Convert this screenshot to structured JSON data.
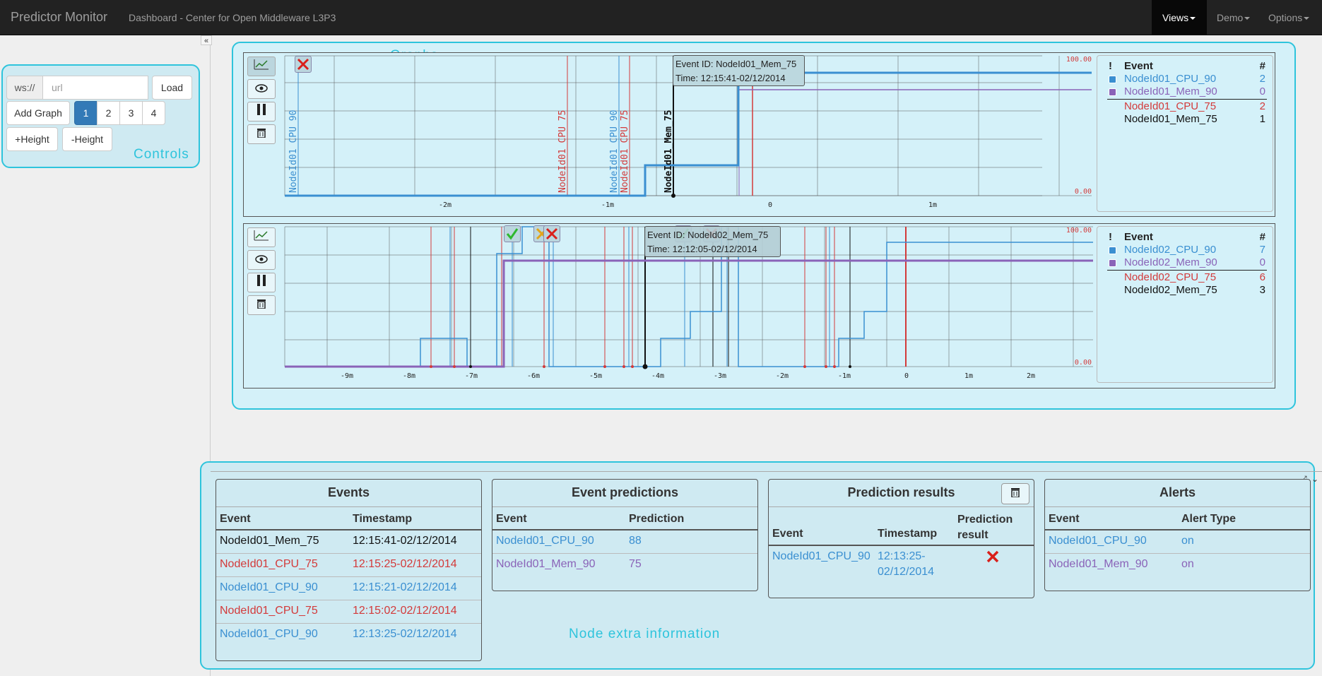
{
  "navbar": {
    "brand": "Predictor Monitor",
    "subtitle": "Dashboard - Center for Open Middleware L3P3",
    "menu": [
      {
        "label": "Views",
        "active": true
      },
      {
        "label": "Demo",
        "active": false
      },
      {
        "label": "Options",
        "active": false
      }
    ]
  },
  "controls": {
    "ws_prefix": "ws://",
    "url_placeholder": "url",
    "load_label": "Load",
    "add_graph_label": "Add Graph",
    "graph_count_options": [
      "1",
      "2",
      "3",
      "4"
    ],
    "selected_count": "1",
    "increase_height_label": "+Height",
    "decrease_height_label": "-Height",
    "collapse_icon": "double-chevron-left-icon"
  },
  "annotations": {
    "controls": "Controls",
    "graphs": "Graphs",
    "node_extra": "Node extra information"
  },
  "colors": {
    "cpu_90": "#3a8fd1",
    "mem_90": "#8a63b8",
    "cpu_75": "#d33a3a",
    "mem_75": "#111111",
    "region_outline": "#2ec4dc",
    "graph_bg": "#d4f1f9",
    "ok": "#2eb82e",
    "fail": "#d9201b",
    "warn": "#e2a51a"
  },
  "graph_buttons": [
    "chart-icon",
    "eye-icon",
    "pause-icon",
    "trash-icon"
  ],
  "graphs": [
    {
      "ymax_label": "100.00",
      "ymin_label": "0.00",
      "x_ticks": [
        "-2m",
        "-1m",
        "0",
        "1m"
      ],
      "tooltip": {
        "event_id": "Event ID: NodeId01_Mem_75",
        "time": "Time: 12:15:41-02/12/2014"
      },
      "event_labels": [
        {
          "text": "NodeId01_CPU_90",
          "series": "cpu_90"
        },
        {
          "text": "NodeId01_CPU_75",
          "series": "cpu_75"
        },
        {
          "text": "NodeId01_CPU_90",
          "series": "cpu_90"
        },
        {
          "text": "NodeId01_CPU_75",
          "series": "cpu_75"
        },
        {
          "text": "NodeId01_Mem_75",
          "series": "mem_75"
        }
      ],
      "legend": {
        "header_bang": "!",
        "header_event": "Event",
        "header_count": "#",
        "rows": [
          {
            "name": "NodeId01_CPU_90",
            "count": "2",
            "series": "cpu_90",
            "marker": true
          },
          {
            "name": "NodeId01_Mem_90",
            "count": "0",
            "series": "mem_90",
            "marker": true
          },
          {
            "name": "NodeId01_CPU_75",
            "count": "2",
            "series": "cpu_75",
            "marker": false
          },
          {
            "name": "NodeId01_Mem_75",
            "count": "1",
            "series": "mem_75",
            "marker": false
          }
        ]
      }
    },
    {
      "ymax_label": "100.00",
      "ymin_label": "0.00",
      "x_ticks": [
        "-9m",
        "-8m",
        "-7m",
        "-6m",
        "-5m",
        "-4m",
        "-3m",
        "-2m",
        "-1m",
        "0",
        "1m",
        "2m"
      ],
      "tooltip": {
        "event_id": "Event ID: NodeId02_Mem_75",
        "time": "Time: 12:12:05-02/12/2014"
      },
      "legend": {
        "header_bang": "!",
        "header_event": "Event",
        "header_count": "#",
        "rows": [
          {
            "name": "NodeId02_CPU_90",
            "count": "7",
            "series": "cpu_90",
            "marker": true
          },
          {
            "name": "NodeId02_Mem_90",
            "count": "0",
            "series": "mem_90",
            "marker": true
          },
          {
            "name": "NodeId02_CPU_75",
            "count": "6",
            "series": "cpu_75",
            "marker": false
          },
          {
            "name": "NodeId02_Mem_75",
            "count": "3",
            "series": "mem_75",
            "marker": false
          }
        ]
      }
    }
  ],
  "events_panel": {
    "title": "Events",
    "headers": [
      "Event",
      "Timestamp"
    ],
    "rows": [
      {
        "event": "NodeId01_Mem_75",
        "timestamp": "12:15:41-02/12/2014",
        "series": "mem_75"
      },
      {
        "event": "NodeId01_CPU_75",
        "timestamp": "12:15:25-02/12/2014",
        "series": "cpu_75"
      },
      {
        "event": "NodeId01_CPU_90",
        "timestamp": "12:15:21-02/12/2014",
        "series": "cpu_90"
      },
      {
        "event": "NodeId01_CPU_75",
        "timestamp": "12:15:02-02/12/2014",
        "series": "cpu_75"
      },
      {
        "event": "NodeId01_CPU_90",
        "timestamp": "12:13:25-02/12/2014",
        "series": "cpu_90"
      }
    ]
  },
  "predictions_panel": {
    "title": "Event predictions",
    "headers": [
      "Event",
      "Prediction"
    ],
    "rows": [
      {
        "event": "NodeId01_CPU_90",
        "prediction": "88",
        "series": "cpu_90"
      },
      {
        "event": "NodeId01_Mem_90",
        "prediction": "75",
        "series": "mem_90"
      }
    ]
  },
  "results_panel": {
    "title": "Prediction results",
    "headers": [
      "Event",
      "Timestamp",
      "Prediction result"
    ],
    "rows": [
      {
        "event": "NodeId01_CPU_90",
        "timestamp_line1": "12:13:25-",
        "timestamp_line2": "02/12/2014",
        "result_icon": "cross-icon"
      }
    ]
  },
  "alerts_panel": {
    "title": "Alerts",
    "headers": [
      "Event",
      "Alert Type"
    ],
    "rows": [
      {
        "event": "NodeId01_CPU_90",
        "type": "on",
        "series": "cpu_90"
      },
      {
        "event": "NodeId01_Mem_90",
        "type": "on",
        "series": "mem_90"
      }
    ]
  }
}
